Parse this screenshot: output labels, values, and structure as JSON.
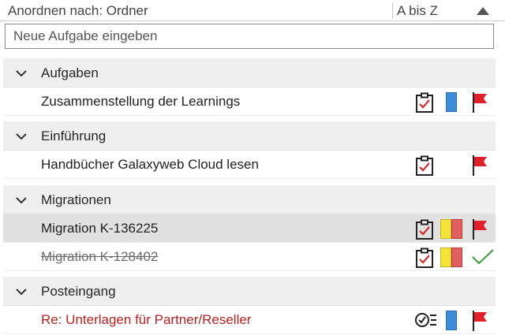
{
  "header": {
    "sort_by": "Anordnen nach: Ordner",
    "order": "A bis Z",
    "sort_arrow_icon": "triangle-up-icon"
  },
  "new_task": {
    "placeholder": "Neue Aufgabe eingeben",
    "value": ""
  },
  "groups": [
    {
      "label": "Aufgaben",
      "tasks": [
        {
          "title": "Zusammenstellung der Learnings",
          "icon": "task-clipboard-icon",
          "categories": [
            "#3d8bd9"
          ],
          "status_icon": "red-flag-icon",
          "completed": false,
          "selected": false
        }
      ]
    },
    {
      "label": "Einführung",
      "tasks": [
        {
          "title": "Handbücher Galaxyweb Cloud lesen",
          "icon": "task-clipboard-icon",
          "categories": [],
          "status_icon": "red-flag-icon",
          "completed": false,
          "selected": false
        }
      ]
    },
    {
      "label": "Migrationen",
      "tasks": [
        {
          "title": "Migration K-136225",
          "icon": "task-clipboard-icon",
          "categories": [
            "#f5e33a",
            "#e0605f"
          ],
          "status_icon": "red-flag-icon",
          "completed": false,
          "selected": true
        },
        {
          "title": "Migration K-128402",
          "icon": "task-clipboard-icon",
          "categories": [
            "#f5e33a",
            "#e0605f"
          ],
          "status_icon": "green-checkmark-icon",
          "completed": true,
          "selected": false
        }
      ]
    },
    {
      "label": "Posteingang",
      "tasks": [
        {
          "title": "Re: Unterlagen für Partner/Reseller",
          "icon": "checklist-icon",
          "categories": [
            "#3d8bd9"
          ],
          "status_icon": "red-flag-icon",
          "completed": false,
          "selected": false,
          "unread_red": true
        }
      ]
    }
  ],
  "colors": {
    "flag": "#e0212b",
    "check": "#3a9a3a",
    "group_background": "#efefef",
    "selected_background": "#e1e1e1"
  }
}
